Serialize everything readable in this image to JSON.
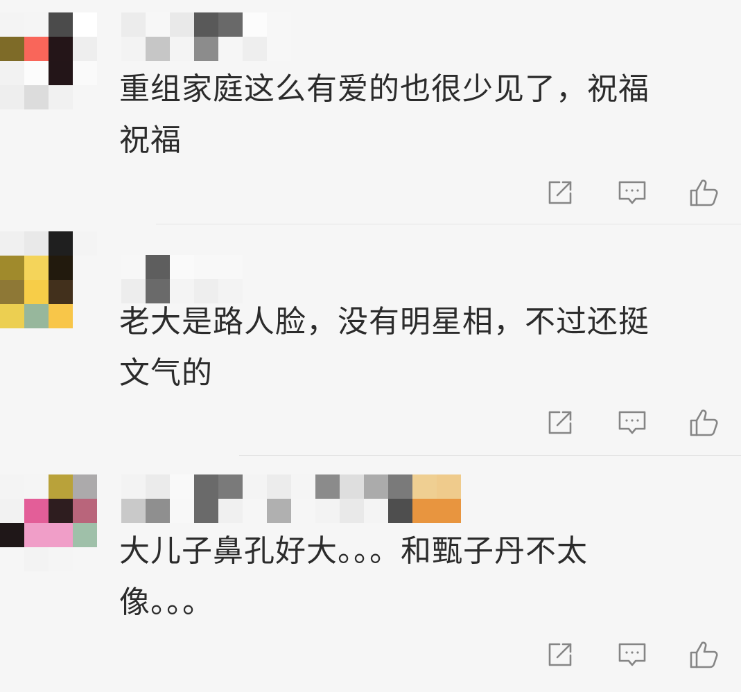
{
  "comments": [
    {
      "text_line1": "重组家庭这么有爱的也很少见了，祝福",
      "text_line2": "祝福",
      "avatar_colors": [
        "#f4f4f4",
        "#f5f5f5",
        "#4b4b4b",
        "#ffffff",
        "#7e6b28",
        "#f9665a",
        "#241518",
        "#eeeeee",
        "#f2f2f2",
        "#fcfcfc",
        "#231518",
        "#fafafa",
        "#eeeeee",
        "#dcdcdc",
        "#f1f1f1",
        "#f6f6f6"
      ],
      "name_colors": [
        "#ececec",
        "#f3f3f3",
        "#f7f7f7",
        "#c6c6c6",
        "#e9e9e9",
        "#f4f4f4",
        "#595959",
        "#8c8c8c",
        "#696969",
        "#f6f6f6",
        "#fcfcfc",
        "#eeeeee",
        "#f7f7f7",
        "#f7f7f7"
      ]
    },
    {
      "text_line1": "老大是路人脸，没有明星相，不过还挺",
      "text_line2": "文气的",
      "avatar_colors": [
        "#f0f0f0",
        "#e9e9e9",
        "#1f1f1f",
        "#f4f4f4",
        "#a08a2c",
        "#f4d45a",
        "#221a0d",
        "#f6f6f6",
        "#8e7836",
        "#f7cd48",
        "#42301c",
        "#f6f6f6",
        "#eccf51",
        "#97b79c",
        "#f8c649",
        "#f6f6f6"
      ],
      "name_colors": [
        "#f7f7f7",
        "#ededed",
        "#5e5e5e",
        "#6a6a6a",
        "#fafafa",
        "#f4f4f4",
        "#f8f8f8",
        "#eeeeee",
        "#f8f8f8",
        "#f3f3f3"
      ]
    },
    {
      "text_line1": "大儿子鼻孔好大。。。和甄子丹不太",
      "text_line2": "像。。。",
      "avatar_colors": [
        "#f4f4f4",
        "#f5f5f5",
        "#b9a23a",
        "#acaaab",
        "#f2f2f2",
        "#e35e98",
        "#2e1d1f",
        "#b9657b",
        "#1f1718",
        "#f09ec8",
        "#f09ec8",
        "#9fc0a9",
        "#f6f6f6",
        "#f3f3f3",
        "#f5f5f5",
        "#f6f6f6"
      ],
      "name_colors": [
        "#f3f3f3",
        "#c9c9c9",
        "#ebebeb",
        "#8f8f8f",
        "#f9f9f9",
        "#f8f8f8",
        "#6a6a6a",
        "#6a6a6a",
        "#7a7a7a",
        "#f0f0f0",
        "#f4f4f4",
        "#f6f6f6",
        "#ececec",
        "#b0b0b0",
        "#f5f5f5",
        "#f6f6f6",
        "#8b8b8b",
        "#f3f3f3",
        "#dedede",
        "#e9e9e9",
        "#ababab",
        "#f4f4f4",
        "#7a7a7a",
        "#4e4e4e",
        "#efcf92",
        "#e8953f",
        "#efcb8c",
        "#e8953f"
      ]
    }
  ],
  "icons": {
    "share": "share-icon",
    "reply": "reply-icon",
    "like": "thumbs-up-icon",
    "color": "#858585"
  }
}
